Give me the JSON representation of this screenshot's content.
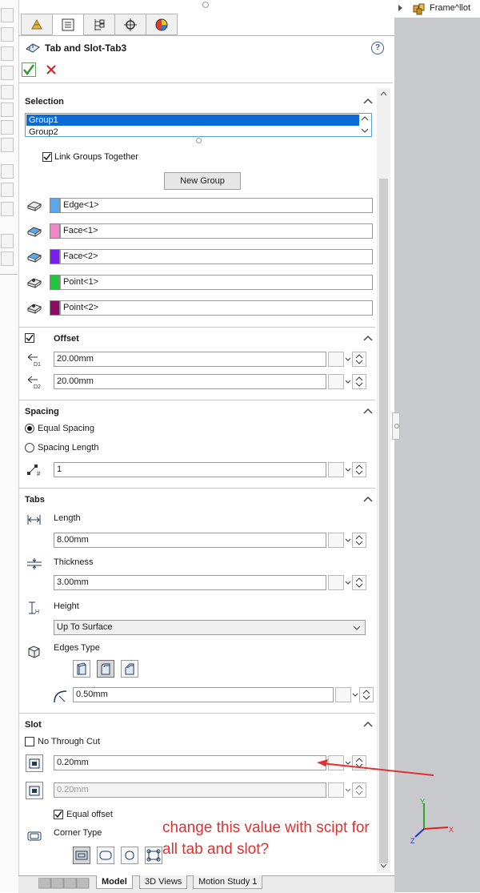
{
  "panel": {
    "title": "Tab and Slot-Tab3",
    "help_glyph": "?"
  },
  "tabs": [
    {
      "name": "feature-manager-icon"
    },
    {
      "name": "property-manager-icon"
    },
    {
      "name": "configuration-manager-icon"
    },
    {
      "name": "dimxpert-icon"
    },
    {
      "name": "display-manager-icon"
    }
  ],
  "selection": {
    "title": "Selection",
    "groups": [
      "Group1",
      "Group2"
    ],
    "selected_group": "Group1",
    "link_groups_label": "Link Groups Together",
    "link_groups_checked": true,
    "new_group_label": "New Group",
    "items": [
      {
        "label": "Edge<1>",
        "color": "#5aa7ee"
      },
      {
        "label": "Face<1>",
        "color": "#ef86c8"
      },
      {
        "label": "Face<2>",
        "color": "#7a1ef0"
      },
      {
        "label": "Point<1>",
        "color": "#1fc83a"
      },
      {
        "label": "Point<2>",
        "color": "#8b0a62"
      }
    ]
  },
  "offset": {
    "title": "Offset",
    "checked": true,
    "d1": "20.00mm",
    "d2": "20.00mm"
  },
  "spacing": {
    "title": "Spacing",
    "equal_label": "Equal Spacing",
    "length_label": "Spacing Length",
    "selected": "Equal Spacing",
    "count": "1"
  },
  "tabs_section": {
    "title": "Tabs",
    "length_label": "Length",
    "length": "8.00mm",
    "thickness_label": "Thickness",
    "thickness": "3.00mm",
    "height_label": "Height",
    "height": "Up To Surface",
    "edges_type_label": "Edges Type",
    "fillet": "0.50mm"
  },
  "slot": {
    "title": "Slot",
    "no_through_cut_label": "No Through Cut",
    "no_through_cut_checked": false,
    "offset1": "0.20mm",
    "offset2": "0.20mm",
    "equal_offset_label": "Equal offset",
    "equal_offset_checked": true,
    "corner_type_label": "Corner Type"
  },
  "tree": {
    "item": "Frame^llot"
  },
  "bottom_tabs": [
    "Model",
    "3D Views",
    "Motion Study 1"
  ],
  "annotation": {
    "line1": "change this value with scipt for",
    "line2": "all tab and slot?",
    "color": "#e03030"
  }
}
